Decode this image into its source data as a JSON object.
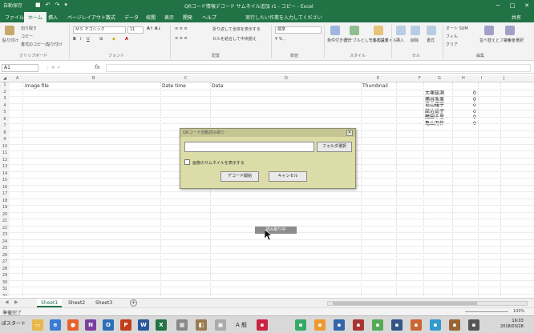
{
  "window": {
    "title": "QRコード情報デコード サムネイル追加 r1 - コピー - Excel",
    "qat_label": "自動保存",
    "controls": [
      "─",
      "□",
      "✕"
    ]
  },
  "menu": {
    "tabs": [
      "ファイル",
      "ホーム",
      "挿入",
      "ページレイアウト",
      "数式",
      "データ",
      "校閲",
      "表示",
      "開発",
      "ヘルプ"
    ],
    "active_tab": "ホーム",
    "tell_me": "実行したい作業を入力してください",
    "share": "共有"
  },
  "ribbon": {
    "paste": "貼り付け",
    "cut": "切り取り",
    "copy": "コピー",
    "format_painter": "書式のコピー/貼り付け",
    "font_name": "ＭＳ Ｐゴシック",
    "font_size": "11",
    "wrap_text": "折り返して全体を表示する",
    "merge_center": "セルを結合して中央揃え",
    "number_format": "標準",
    "conditional_format": "条件付き書式",
    "format_as_table": "テーブルとして書式設定",
    "cell_styles": "セルのスタイル",
    "insert": "挿入",
    "delete": "削除",
    "format": "書式",
    "autosum": "オート SUM",
    "fill": "フィル",
    "clear": "クリア",
    "sort_filter": "並べ替えとフィルター",
    "find_select": "検索と選択",
    "groups": [
      "クリップボード",
      "フォント",
      "配置",
      "数値",
      "スタイル",
      "セル",
      "編集"
    ]
  },
  "formula_bar": {
    "name_box": "A1",
    "fx": "fx",
    "value": ""
  },
  "grid": {
    "columns": [
      "A",
      "B",
      "C",
      "D",
      "E",
      "F",
      "G",
      "H",
      "I",
      "J"
    ],
    "rows": [
      "1",
      "2",
      "3",
      "4",
      "5",
      "6",
      "7",
      "8",
      "9",
      "10",
      "11",
      "12",
      "13",
      "14",
      "15",
      "16",
      "17",
      "18",
      "19",
      "20",
      "21",
      "22",
      "23",
      "24",
      "25",
      "26",
      "27",
      "28",
      "29",
      "30",
      "31",
      "32"
    ],
    "headers": {
      "image_file": "Image file",
      "date_time": "Date time",
      "data": "Data",
      "thumbnail": "Thumbnail"
    },
    "names": [
      "大塚茲洞",
      "猪谷朱美",
      "島山耀子",
      "館佐総子",
      "鶴田千里",
      "亀山万作"
    ],
    "counts": [
      "0",
      "0",
      "0",
      "0",
      "0",
      "0"
    ]
  },
  "dialog": {
    "title": "QRコード自動読み取り",
    "close": "✕",
    "input_value": "",
    "folder_button": "フォルダ選択",
    "checkbox_label": "画像のサムネイルを表示する",
    "decode_button": "デコード開始",
    "cancel_button": "キャンセル"
  },
  "tooltip": "読み取り中",
  "sheets": {
    "tabs": [
      "Sheet1",
      "Sheet2",
      "Sheet3"
    ],
    "active": "Sheet1",
    "add": "+"
  },
  "status": {
    "ready": "準備完了",
    "zoom": "100%"
  },
  "taskbar": {
    "start": "ぽスタート",
    "time": "16:03",
    "date": "2018/03/28"
  },
  "colors": {
    "excel_green": "#217346",
    "dialog_bg": "#dcdca8"
  }
}
